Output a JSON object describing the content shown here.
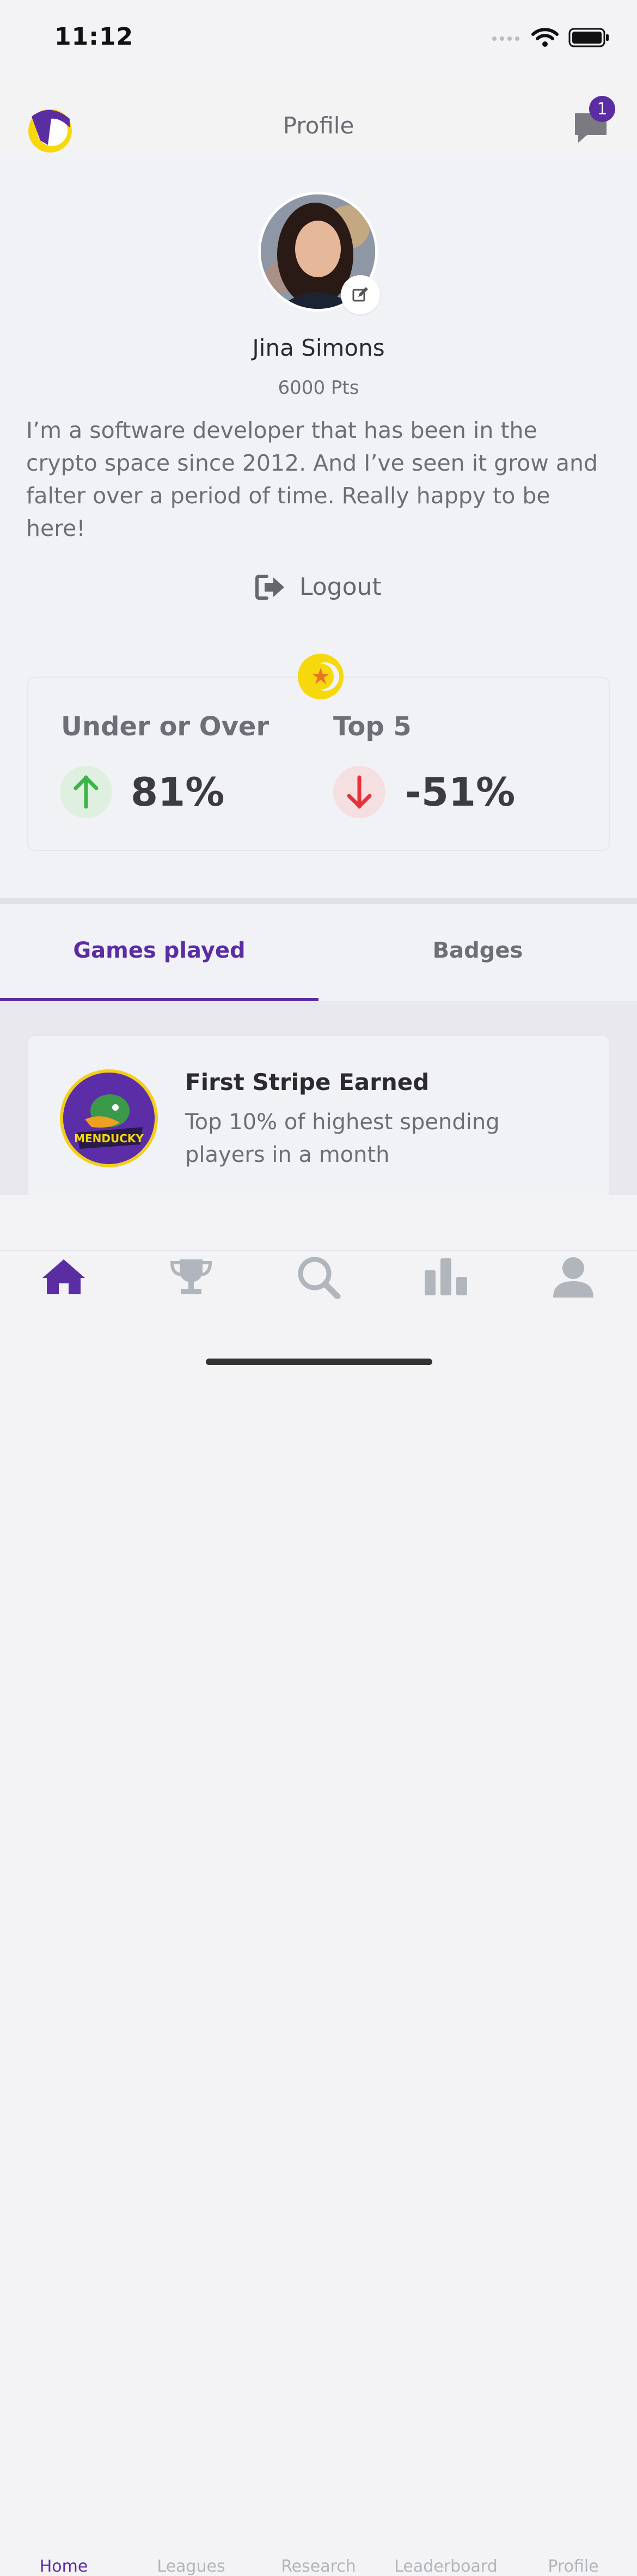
{
  "status_bar": {
    "time": "11:12"
  },
  "header": {
    "title": "Profile",
    "notification_count": "1"
  },
  "profile": {
    "name": "Jina Simons",
    "points": "6000 Pts",
    "bio": "I’m a software developer that has been in the crypto space since 2012. And I’ve seen it grow and falter over a period of time. Really happy to be here!",
    "logout_label": "Logout"
  },
  "stats": [
    {
      "label": "Under or Over",
      "value": "81%",
      "trend": "up",
      "color": "#3bb54a"
    },
    {
      "label": "Top 5",
      "value": "-51%",
      "trend": "down",
      "color": "#e8323a"
    }
  ],
  "tabs": [
    {
      "label": "Games played",
      "active": true
    },
    {
      "label": "Badges",
      "active": false
    }
  ],
  "games": [
    {
      "title": "First Stripe Earned",
      "description": "Top 10% of highest spending players in a month",
      "badge_text": "MENDUCKY"
    }
  ],
  "nav": [
    {
      "label": "Home",
      "icon": "home-icon",
      "active": true
    },
    {
      "label": "Leagues",
      "icon": "trophy-icon",
      "active": false
    },
    {
      "label": "Research",
      "icon": "search-icon",
      "active": false
    },
    {
      "label": "Leaderboard",
      "icon": "bar-chart-icon",
      "active": false
    },
    {
      "label": "Profile",
      "icon": "user-icon",
      "active": false
    }
  ],
  "colors": {
    "accent": "#5b2da3",
    "inactive": "#b1b5bc",
    "coin": "#f6d80c"
  }
}
